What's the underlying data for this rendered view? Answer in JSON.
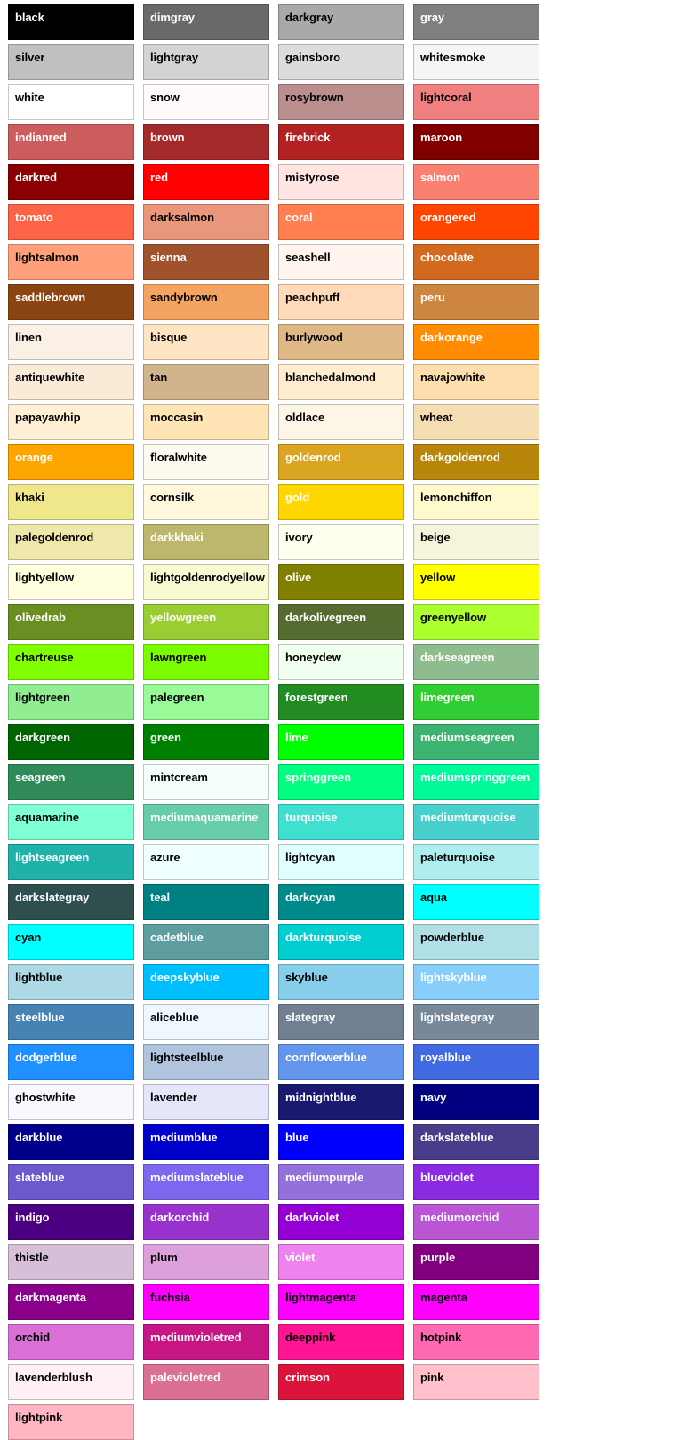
{
  "chart_data": {
    "type": "table",
    "title": "CSS Named Colors Swatch Chart",
    "xlabel": "",
    "ylabel": "",
    "columns": 5,
    "grid": false,
    "legend": "none",
    "categories": [
      "black",
      "dimgray",
      "darkgray",
      "gray",
      "silver",
      "lightgray",
      "gainsboro",
      "whitesmoke",
      "white",
      "snow",
      "rosybrown",
      "lightcoral",
      "indianred",
      "brown",
      "firebrick",
      "maroon",
      "darkred",
      "red",
      "mistyrose",
      "salmon",
      "tomato",
      "darksalmon",
      "coral",
      "orangered",
      "lightsalmon",
      "sienna",
      "seashell",
      "chocolate",
      "saddlebrown",
      "sandybrown",
      "peachpuff",
      "peru",
      "linen",
      "bisque",
      "burlywood",
      "darkorange",
      "antiquewhite",
      "tan",
      "blanchedalmond",
      "navajowhite",
      "papayawhip",
      "moccasin",
      "oldlace",
      "wheat",
      "orange",
      "floralwhite",
      "goldenrod",
      "darkgoldenrod",
      "khaki",
      "cornsilk",
      "gold",
      "lemonchiffon",
      "palegoldenrod",
      "darkkhaki",
      "ivory",
      "beige",
      "lightyellow",
      "lightgoldenrodyellow",
      "olive",
      "yellow",
      "olivedrab",
      "yellowgreen",
      "darkolivegreen",
      "greenyellow",
      "chartreuse",
      "lawngreen",
      "honeydew",
      "darkseagreen",
      "lightgreen",
      "palegreen",
      "forestgreen",
      "limegreen",
      "darkgreen",
      "green",
      "lime",
      "mediumseagreen",
      "seagreen",
      "mintcream",
      "springgreen",
      "mediumspringgreen",
      "aquamarine",
      "mediumaquamarine",
      "turquoise",
      "mediumturquoise",
      "lightseagreen",
      "azure",
      "lightcyan",
      "paleturquoise",
      "darkslategray",
      "teal",
      "darkcyan",
      "aqua",
      "cyan",
      "cadetblue",
      "darkturquoise",
      "powderblue",
      "lightblue",
      "deepskyblue",
      "skyblue",
      "lightskyblue",
      "steelblue",
      "aliceblue",
      "slategray",
      "lightslategray",
      "dodgerblue",
      "lightsteelblue",
      "cornflowerblue",
      "royalblue",
      "ghostwhite",
      "lavender",
      "midnightblue",
      "navy",
      "darkblue",
      "mediumblue",
      "blue",
      "darkslateblue",
      "slateblue",
      "mediumslateblue",
      "mediumpurple",
      "blueviolet",
      "indigo",
      "darkorchid",
      "darkviolet",
      "mediumorchid",
      "thistle",
      "plum",
      "violet",
      "purple",
      "darkmagenta",
      "fuchsia",
      "lightmagenta",
      "magenta",
      "orchid",
      "mediumvioletred",
      "deeppink",
      "hotpink",
      "lavenderblush",
      "palevioletred",
      "crimson",
      "pink",
      "lightpink"
    ],
    "values": [
      "#000000",
      "#696969",
      "#a9a9a9",
      "#808080",
      "#c0c0c0",
      "#d3d3d3",
      "#dcdcdc",
      "#f5f5f5",
      "#ffffff",
      "#fffafa",
      "#bc8f8f",
      "#f08080",
      "#cd5c5c",
      "#a52a2a",
      "#b22222",
      "#800000",
      "#8b0000",
      "#ff0000",
      "#ffe4e1",
      "#fa8072",
      "#ff6347",
      "#e9967a",
      "#ff7f50",
      "#ff4500",
      "#ffa07a",
      "#a0522d",
      "#fff5ee",
      "#d2691e",
      "#8b4513",
      "#f4a460",
      "#ffdab9",
      "#cd853f",
      "#faf0e6",
      "#ffe4c4",
      "#deb887",
      "#ff8c00",
      "#faebd7",
      "#d2b48c",
      "#ffebcd",
      "#ffdead",
      "#ffefd5",
      "#ffe4b5",
      "#fdf5e6",
      "#f5deb3",
      "#ffa500",
      "#fffaf0",
      "#daa520",
      "#b8860b",
      "#f0e68c",
      "#fff8dc",
      "#ffd700",
      "#fffacd",
      "#eee8aa",
      "#bdb76b",
      "#fffff0",
      "#f5f5dc",
      "#ffffe0",
      "#fafad2",
      "#808000",
      "#ffff00",
      "#6b8e23",
      "#9acd32",
      "#556b2f",
      "#adff2f",
      "#7fff00",
      "#7cfc00",
      "#f0fff0",
      "#8fbc8f",
      "#90ee90",
      "#98fb98",
      "#228b22",
      "#32cd32",
      "#006400",
      "#008000",
      "#00ff00",
      "#3cb371",
      "#2e8b57",
      "#f5fffa",
      "#00ff7f",
      "#00fa9a",
      "#7fffd4",
      "#66cdaa",
      "#40e0d0",
      "#48d1cc",
      "#20b2aa",
      "#f0ffff",
      "#e0ffff",
      "#afeeee",
      "#2f4f4f",
      "#008080",
      "#008b8b",
      "#00ffff",
      "#00ffff",
      "#5f9ea0",
      "#00ced1",
      "#b0e0e6",
      "#add8e6",
      "#00bfff",
      "#87ceeb",
      "#87cefa",
      "#4682b4",
      "#f0f8ff",
      "#708090",
      "#778899",
      "#1e90ff",
      "#b0c4de",
      "#6495ed",
      "#4169e1",
      "#f8f8ff",
      "#e6e6fa",
      "#191970",
      "#000080",
      "#00008b",
      "#0000cd",
      "#0000ff",
      "#483d8b",
      "#6a5acd",
      "#7b68ee",
      "#9370db",
      "#8a2be2",
      "#4b0082",
      "#9932cc",
      "#9400d3",
      "#ba55d3",
      "#d8bfd8",
      "#dda0dd",
      "#ee82ee",
      "#800080",
      "#8b008b",
      "#ff00ff",
      "#ff00ff",
      "#ff00ff",
      "#da70d6",
      "#c71585",
      "#ff1493",
      "#ff69b4",
      "#fff0f5",
      "#db7093",
      "#dc143c",
      "#ffc0cb",
      "#ffb6c1"
    ],
    "label_colors": [
      "white",
      "white",
      "black",
      "white",
      "black",
      "black",
      "black",
      "black",
      "black",
      "black",
      "black",
      "black",
      "white",
      "white",
      "white",
      "white",
      "white",
      "white",
      "black",
      "white",
      "white",
      "black",
      "white",
      "white",
      "black",
      "white",
      "black",
      "white",
      "white",
      "black",
      "black",
      "white",
      "black",
      "black",
      "black",
      "white",
      "black",
      "black",
      "black",
      "black",
      "black",
      "black",
      "black",
      "black",
      "white",
      "black",
      "white",
      "white",
      "black",
      "black",
      "white",
      "black",
      "black",
      "white",
      "black",
      "black",
      "black",
      "black",
      "white",
      "black",
      "white",
      "white",
      "white",
      "black",
      "black",
      "black",
      "black",
      "white",
      "black",
      "black",
      "white",
      "white",
      "white",
      "white",
      "white",
      "white",
      "white",
      "black",
      "white",
      "white",
      "black",
      "white",
      "white",
      "white",
      "white",
      "black",
      "black",
      "black",
      "white",
      "white",
      "white",
      "black",
      "black",
      "white",
      "white",
      "black",
      "black",
      "white",
      "black",
      "white",
      "white",
      "black",
      "white",
      "white",
      "white",
      "black",
      "white",
      "white",
      "black",
      "black",
      "white",
      "white",
      "white",
      "white",
      "white",
      "white",
      "white",
      "white",
      "white",
      "white",
      "white",
      "white",
      "white",
      "white",
      "black",
      "black",
      "white",
      "white",
      "white",
      "black",
      "black",
      "black",
      "black",
      "white",
      "black",
      "black",
      "black",
      "white",
      "white",
      "black",
      "black"
    ]
  }
}
